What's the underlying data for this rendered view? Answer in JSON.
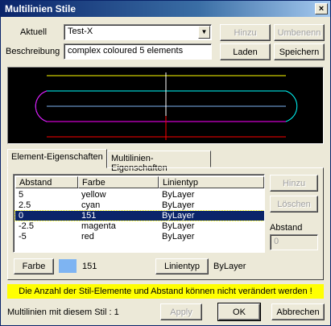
{
  "window": {
    "title": "Multilinien Stile",
    "close_label": "×"
  },
  "style_row": {
    "current_label": "Aktuell",
    "current_value": "Test-X",
    "description_label": "Beschreibung",
    "description_value": "complex coloured 5 elements"
  },
  "buttons": {
    "add_style": "Hinzu",
    "rename": "Umbenenn",
    "load": "Laden",
    "save": "Speichern",
    "add_element": "Hinzu",
    "delete_element": "Löschen",
    "color": "Farbe",
    "linetype": "Linientyp",
    "apply": "Apply",
    "ok": "OK",
    "cancel": "Abbrechen"
  },
  "tabs": {
    "element_props": "Element-Eigenschaften",
    "multiline_props": "Multilinien-Eigenschaften"
  },
  "element_table": {
    "columns": [
      "Abstand",
      "Farbe",
      "Linientyp"
    ],
    "rows": [
      {
        "offset": "5",
        "color": "yellow",
        "linetype": "ByLayer"
      },
      {
        "offset": "2.5",
        "color": "cyan",
        "linetype": "ByLayer"
      },
      {
        "offset": "0",
        "color": "151",
        "linetype": "ByLayer"
      },
      {
        "offset": "-2.5",
        "color": "magenta",
        "linetype": "ByLayer"
      },
      {
        "offset": "-5",
        "color": "red",
        "linetype": "ByLayer"
      }
    ],
    "selected_index": 2
  },
  "offset_panel": {
    "label": "Abstand",
    "value": "0"
  },
  "color_row": {
    "color_value": "151",
    "linetype_value": "ByLayer",
    "swatch_color": "#7eb4f2"
  },
  "warning_text": "Die Anzahl der Stil-Elemente und Abstand können nicht verändert werden !",
  "status_text": "Multilinien mit diesem Stil : 1",
  "preview_colors": {
    "yellow": "#ffff00",
    "cyan": "#00ffff",
    "color151": "#7eb4f2",
    "magenta": "#ff00ff",
    "red": "#ff0000",
    "white": "#ffffff"
  }
}
